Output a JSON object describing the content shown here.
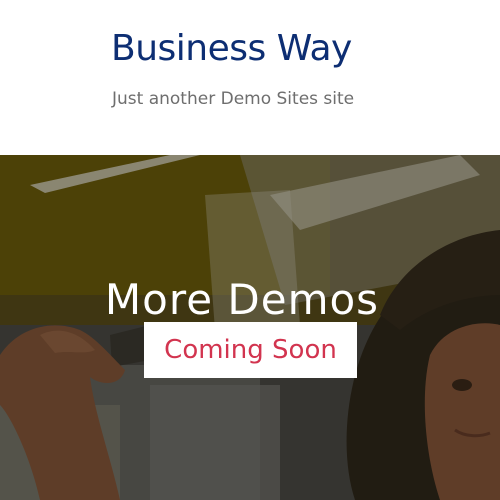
{
  "header": {
    "site_title": "Business Way",
    "tagline": "Just another Demo Sites site"
  },
  "hero": {
    "heading": "More Demos",
    "badge": "Coming Soon"
  },
  "colors": {
    "site_title": "#0d2e73",
    "tagline": "#6e6e6e",
    "badge_text": "#d2344f",
    "badge_bg": "#ffffff",
    "hero_overlay": "#2b2414"
  }
}
